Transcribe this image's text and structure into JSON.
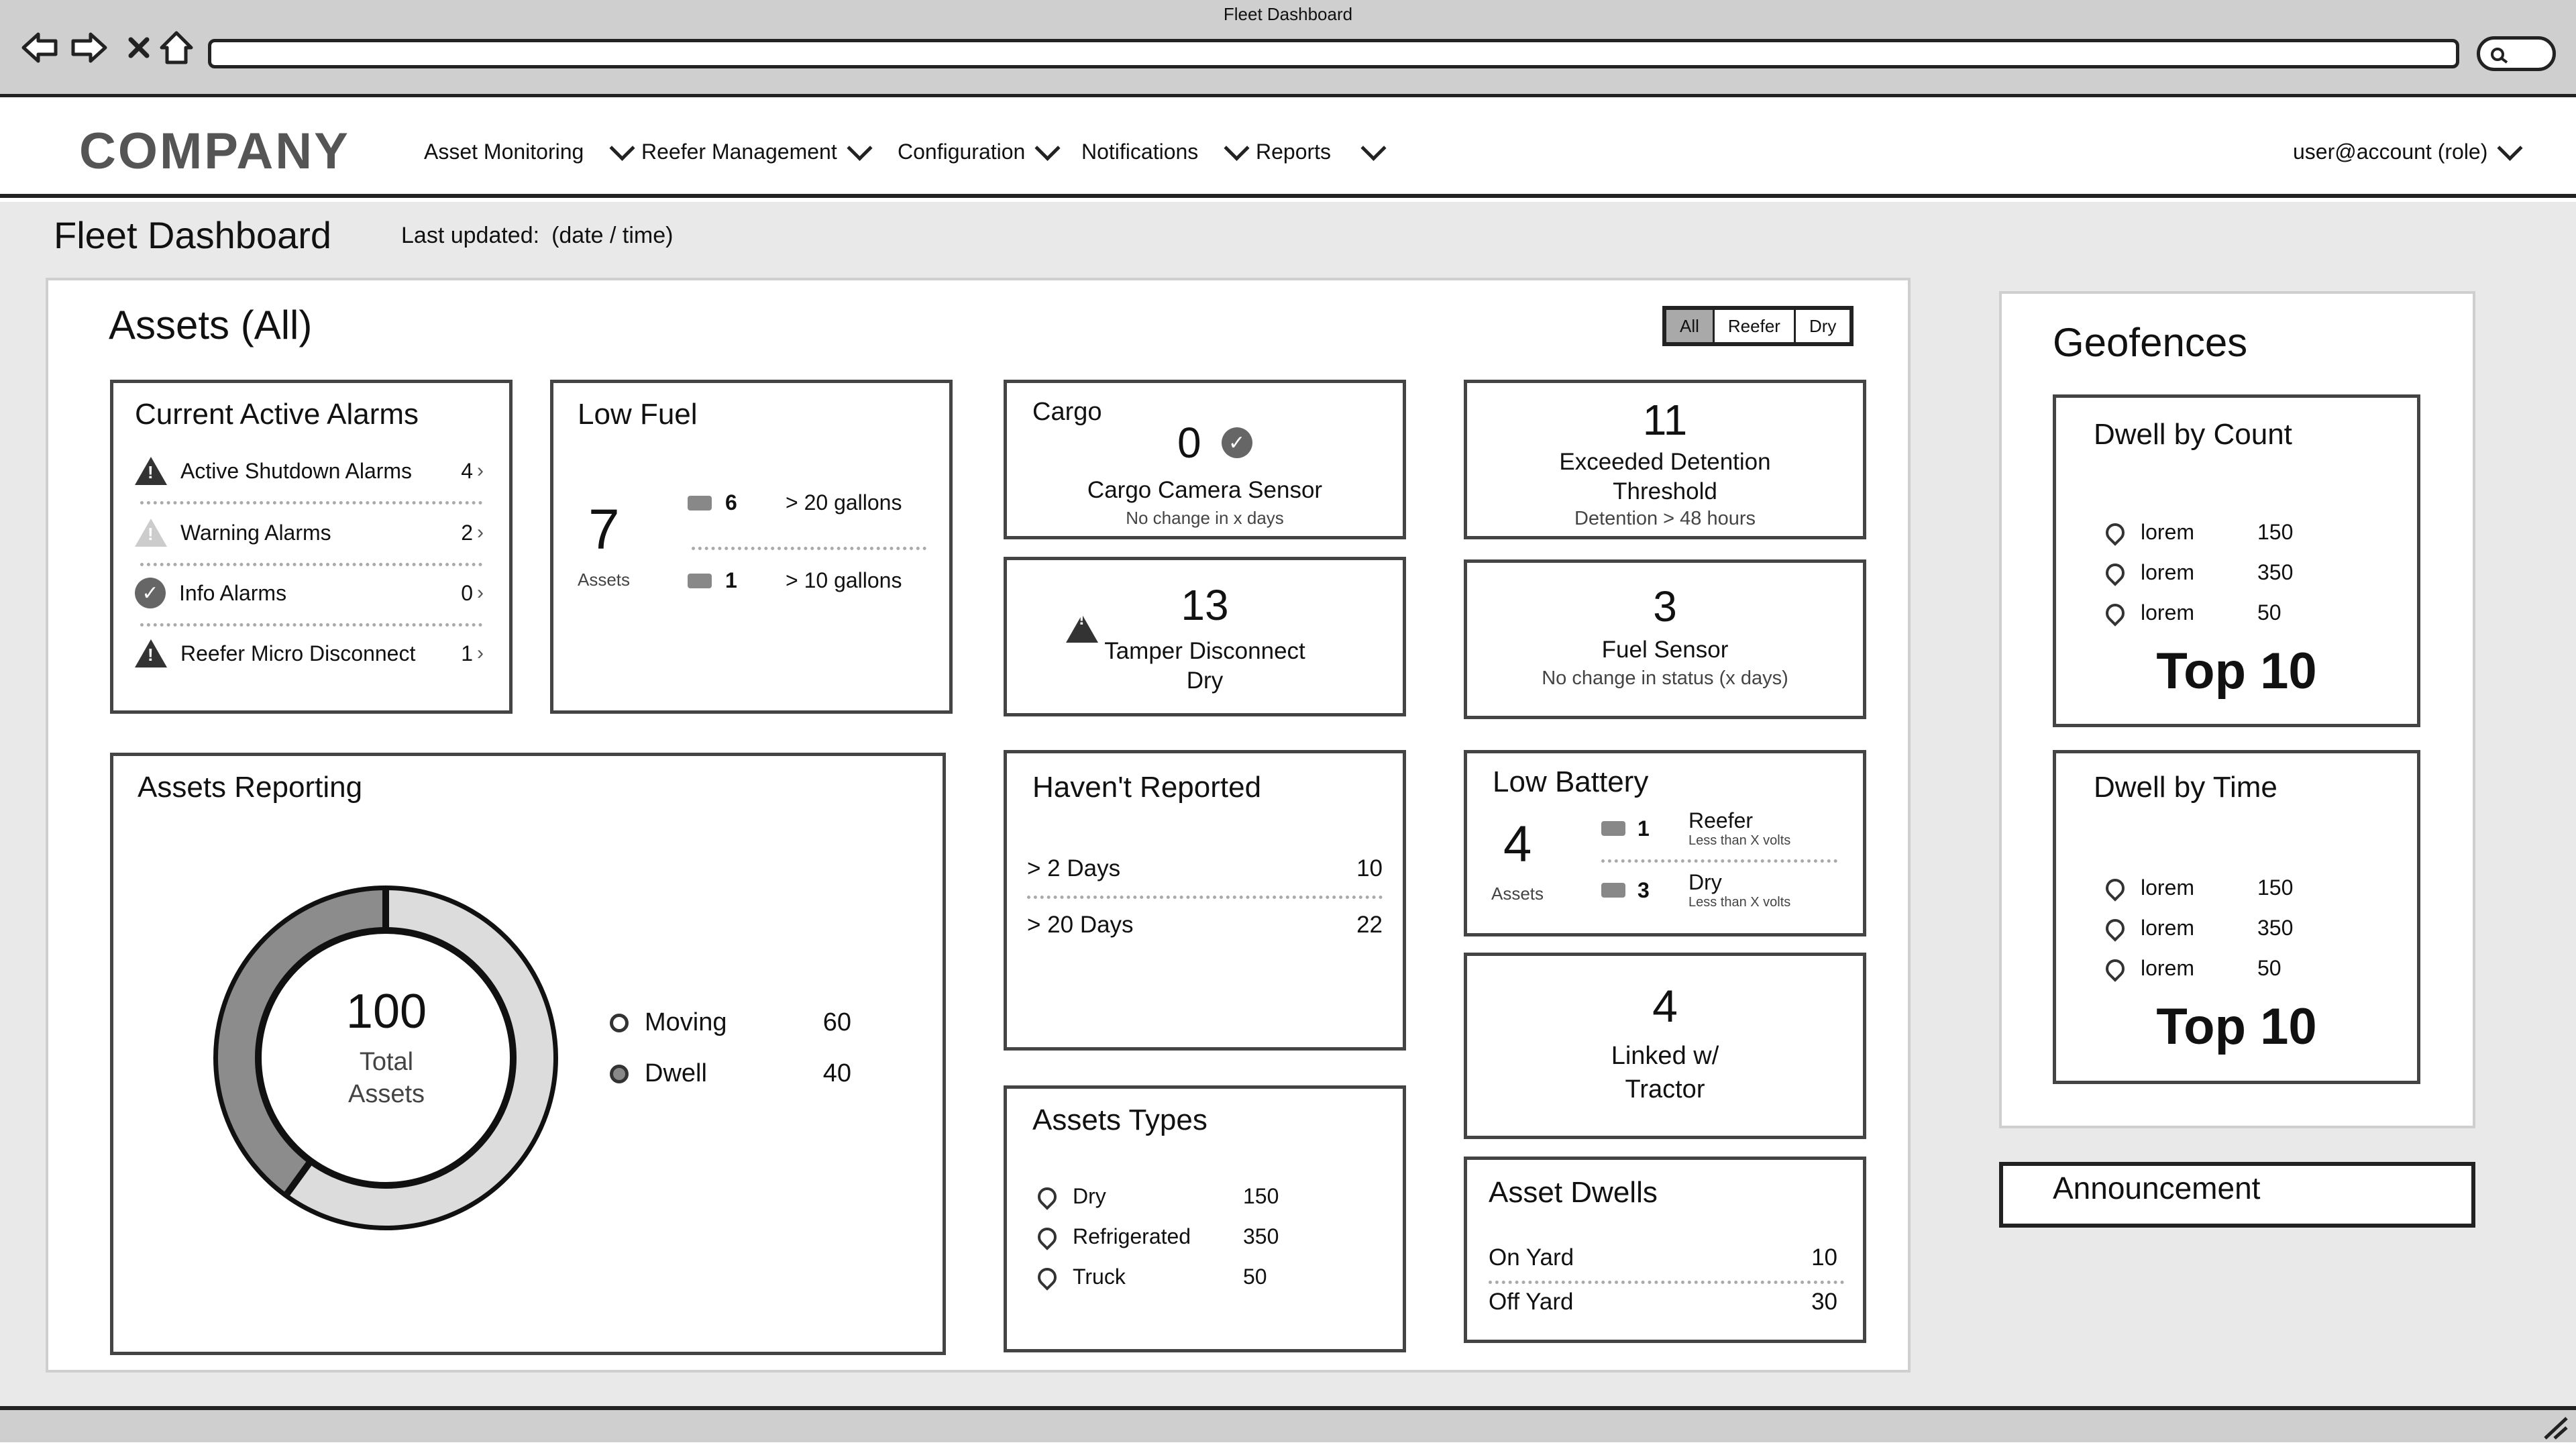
{
  "browser": {
    "title": "Fleet Dashboard"
  },
  "header": {
    "logo": "COMPANY",
    "nav": [
      "Asset Monitoring",
      "Reefer Management",
      "Configuration",
      "Notifications",
      "Reports"
    ],
    "user": "user@account (role)"
  },
  "page": {
    "title": "Fleet Dashboard",
    "last_updated_label": "Last updated:",
    "last_updated_value": "(date / time)"
  },
  "assets": {
    "title": "Assets (All)",
    "filters": [
      "All",
      "Reefer",
      "Dry"
    ],
    "active_filter": "All"
  },
  "alarms": {
    "title": "Current Active Alarms",
    "items": [
      {
        "label": "Active Shutdown Alarms",
        "count": "4",
        "icon": "warning-icon"
      },
      {
        "label": "Warning Alarms",
        "count": "2",
        "icon": "warning-light-icon"
      },
      {
        "label": "Info Alarms",
        "count": "0",
        "icon": "check-icon"
      },
      {
        "label": "Reefer Micro Disconnect",
        "count": "1",
        "icon": "warning-icon"
      }
    ]
  },
  "low_fuel": {
    "title": "Low Fuel",
    "total": "7",
    "total_label": "Assets",
    "rows": [
      {
        "count": "6",
        "label": "> 20 gallons"
      },
      {
        "count": "1",
        "label": "> 10 gallons"
      }
    ]
  },
  "cargo": {
    "title": "Cargo",
    "value": "0",
    "label": "Cargo Camera Sensor",
    "sub": "No change in x days"
  },
  "detention": {
    "value": "11",
    "label_line1": "Exceeded Detention",
    "label_line2": "Threshold",
    "sub": "Detention > 48 hours"
  },
  "tamper": {
    "value": "13",
    "label_line1": "Tamper Disconnect",
    "label_line2": "Dry"
  },
  "fuel_sensor": {
    "value": "3",
    "label": "Fuel Sensor",
    "sub": "No change in status (x days)"
  },
  "assets_reporting": {
    "title": "Assets Reporting",
    "total": "100",
    "total_label_line1": "Total",
    "total_label_line2": "Assets",
    "legend": [
      {
        "label": "Moving",
        "value": "60"
      },
      {
        "label": "Dwell",
        "value": "40"
      }
    ]
  },
  "havent_reported": {
    "title": "Haven't Reported",
    "rows": [
      {
        "label": "> 2 Days",
        "value": "10"
      },
      {
        "label": "> 20 Days",
        "value": "22"
      }
    ]
  },
  "low_battery": {
    "title": "Low Battery",
    "total": "4",
    "total_label": "Assets",
    "rows": [
      {
        "count": "1",
        "label": "Reefer",
        "sub": "Less than X volts"
      },
      {
        "count": "3",
        "label": "Dry",
        "sub": "Less than X volts"
      }
    ]
  },
  "linked": {
    "value": "4",
    "label_line1": "Linked w/",
    "label_line2": "Tractor"
  },
  "asset_types": {
    "title": "Assets Types",
    "rows": [
      {
        "label": "Dry",
        "value": "150"
      },
      {
        "label": "Refrigerated",
        "value": "350"
      },
      {
        "label": "Truck",
        "value": "50"
      }
    ]
  },
  "asset_dwells": {
    "title": "Asset Dwells",
    "rows": [
      {
        "label": "On Yard",
        "value": "10"
      },
      {
        "label": "Off Yard",
        "value": "30"
      }
    ]
  },
  "geofences": {
    "title": "Geofences",
    "dwell_count": {
      "title": "Dwell by Count",
      "rows": [
        {
          "label": "lorem",
          "value": "150"
        },
        {
          "label": "lorem",
          "value": "350"
        },
        {
          "label": "lorem",
          "value": "50"
        }
      ],
      "footer": "Top 10"
    },
    "dwell_time": {
      "title": "Dwell by Time",
      "rows": [
        {
          "label": "lorem",
          "value": "150"
        },
        {
          "label": "lorem",
          "value": "350"
        },
        {
          "label": "lorem",
          "value": "50"
        }
      ],
      "footer": "Top 10"
    }
  },
  "announcement": {
    "title": "Announcement"
  },
  "colors": {
    "ink": "#222222",
    "page_bg": "#e9e9e9",
    "donut_moving": "#dcdcdc",
    "donut_dwell": "#8c8c8c"
  }
}
